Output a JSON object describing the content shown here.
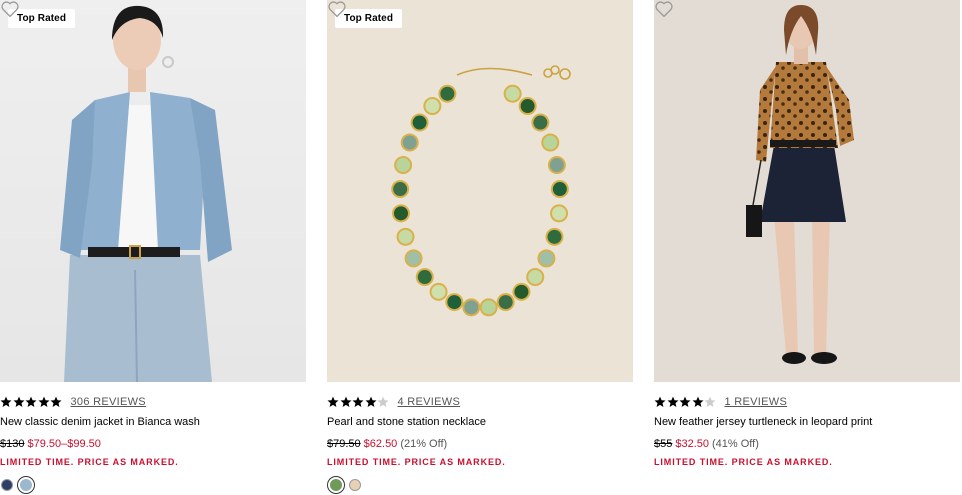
{
  "products": [
    {
      "badge": "Top Rated",
      "rating": 5,
      "reviews": "306 REVIEWS",
      "name": "New classic denim jacket in Bianca wash",
      "original_price": "$130",
      "sale_price": "$79.50–$99.50",
      "discount": "",
      "promo": "LIMITED TIME. PRICE AS MARKED.",
      "swatches": [
        {
          "color": "#2d3f66",
          "selected": false
        },
        {
          "color": "#9db7cc",
          "selected": true
        }
      ]
    },
    {
      "badge": "Top Rated",
      "rating": 4,
      "reviews": "4 REVIEWS",
      "name": "Pearl and stone station necklace",
      "original_price": "$79.50",
      "sale_price": "$62.50",
      "discount": "(21% Off)",
      "promo": "LIMITED TIME. PRICE AS MARKED.",
      "swatches": [
        {
          "color": "#6f9a5a",
          "selected": true
        },
        {
          "color": "#e7d1b4",
          "selected": false
        }
      ]
    },
    {
      "badge": "",
      "rating": 4,
      "reviews": "1 REVIEWS",
      "name": "New feather jersey turtleneck in leopard print",
      "original_price": "$55",
      "sale_price": "$32.50",
      "discount": "(41% Off)",
      "promo": "LIMITED TIME. PRICE AS MARKED.",
      "swatches": []
    }
  ],
  "colors": {
    "sale": "#c8102e",
    "star": "#000000",
    "star_empty": "#cccccc"
  }
}
